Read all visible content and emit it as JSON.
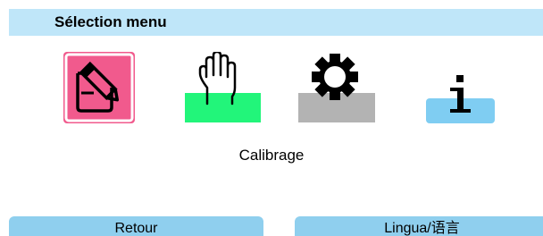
{
  "header": {
    "title": "Sélection menu"
  },
  "menu": {
    "items": [
      {
        "id": "calibration",
        "icon": "calibration-icon",
        "color": "#f15a8d",
        "selected": true
      },
      {
        "id": "manual",
        "icon": "hand-icon",
        "color": "#22f57a",
        "selected": false
      },
      {
        "id": "settings",
        "icon": "gear-icon",
        "color": "#b3b3b3",
        "selected": false
      },
      {
        "id": "info",
        "icon": "info-icon",
        "color": "#7fcdf2",
        "selected": false
      }
    ],
    "selected_label": "Calibrage"
  },
  "softkeys": {
    "left_label": "Retour",
    "right_label": "Lingua/语言"
  },
  "colors": {
    "header_bg": "#bfe6f9",
    "softkey_bg": "#8fcfee"
  }
}
